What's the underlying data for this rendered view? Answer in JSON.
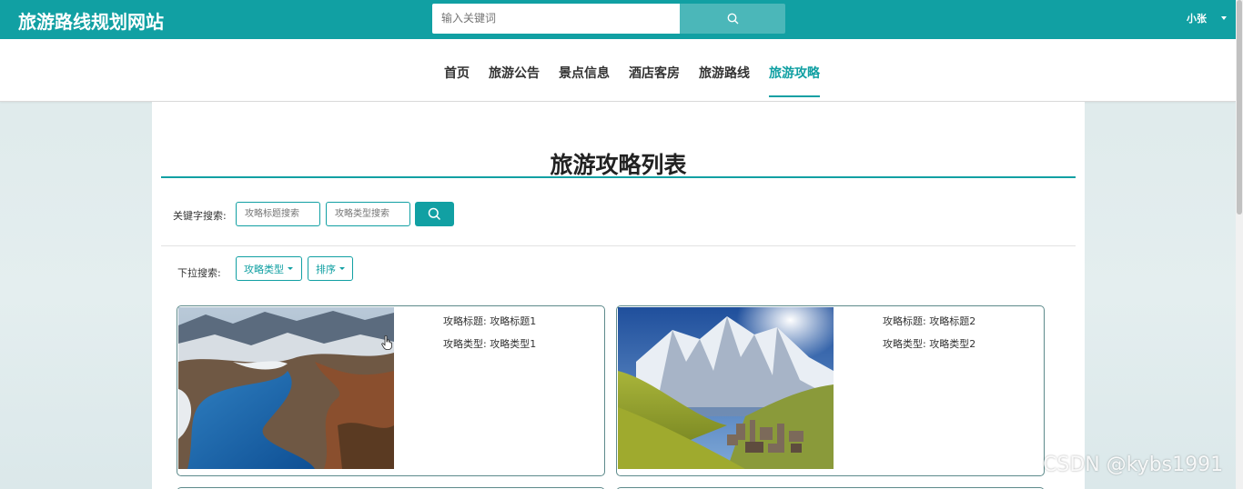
{
  "header": {
    "site_title": "旅游路线规划网站",
    "search_placeholder": "输入关键词",
    "search_icon": "search-icon",
    "user_name": "小张"
  },
  "nav": {
    "items": [
      {
        "label": "首页"
      },
      {
        "label": "旅游公告"
      },
      {
        "label": "景点信息"
      },
      {
        "label": "酒店客房"
      },
      {
        "label": "旅游路线"
      },
      {
        "label": "旅游攻略"
      }
    ],
    "active": "旅游攻略"
  },
  "main": {
    "page_title": "旅游攻略列表",
    "keyword_label": "关键字搜索:",
    "title_search_placeholder": "攻略标题搜索",
    "type_search_placeholder": "攻略类型搜索",
    "dropdown_label": "下拉搜索:",
    "type_dropdown": "攻略类型",
    "sort_dropdown": "排序",
    "cards": [
      {
        "title_label": "攻略标题:",
        "title": "攻略标题1",
        "type_label": "攻略类型:",
        "type": "攻略类型1",
        "image": "canyon-lake-photo"
      },
      {
        "title_label": "攻略标题:",
        "title": "攻略标题2",
        "type_label": "攻略类型:",
        "type": "攻略类型2",
        "image": "mountain-village-photo"
      }
    ]
  },
  "watermark": "CSDN @kybs1991",
  "colors": {
    "accent": "#11a0a3",
    "header_bg": "#11a0a3",
    "search_btn": "#4bb7b9"
  }
}
